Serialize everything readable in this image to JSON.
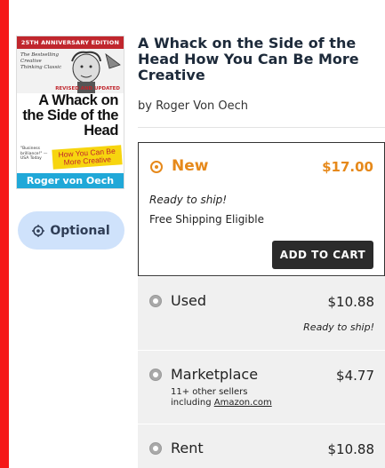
{
  "cover": {
    "band": "25TH ANNIVERSARY EDITION",
    "blurb": "The Bestselling Creative Thinking Classic",
    "edition": "REVISED AND UPDATED",
    "title": "A Whack on the Side of the Head",
    "quote": "\"Business brilliance!\" —USA Today",
    "subtitle": "How You Can Be More Creative",
    "author": "Roger von Oech"
  },
  "optional_button": {
    "label": "Optional",
    "icon": "target-icon"
  },
  "book": {
    "title": "A Whack on the Side of the Head How You Can Be More Creative",
    "author": "by Roger Von Oech"
  },
  "options": {
    "new": {
      "label": "New",
      "price": "$17.00",
      "shipping": "Ready to ship!",
      "free_shipping": "Free Shipping Eligible",
      "add_to_cart": "ADD TO CART"
    },
    "used": {
      "label": "Used",
      "price": "$10.88",
      "note": "Ready to ship!"
    },
    "marketplace": {
      "label": "Marketplace",
      "price": "$4.77",
      "sellers_text": "11+ other sellers",
      "sellers_prefix": "including",
      "sellers_link": "Amazon.com"
    },
    "rent": {
      "label": "Rent",
      "price": "$10.88"
    }
  },
  "colors": {
    "accent_orange": "#e6891b",
    "left_bar_red": "#f51818",
    "optional_bg": "#cfe2fb",
    "cart_button": "#2b2b2b"
  }
}
